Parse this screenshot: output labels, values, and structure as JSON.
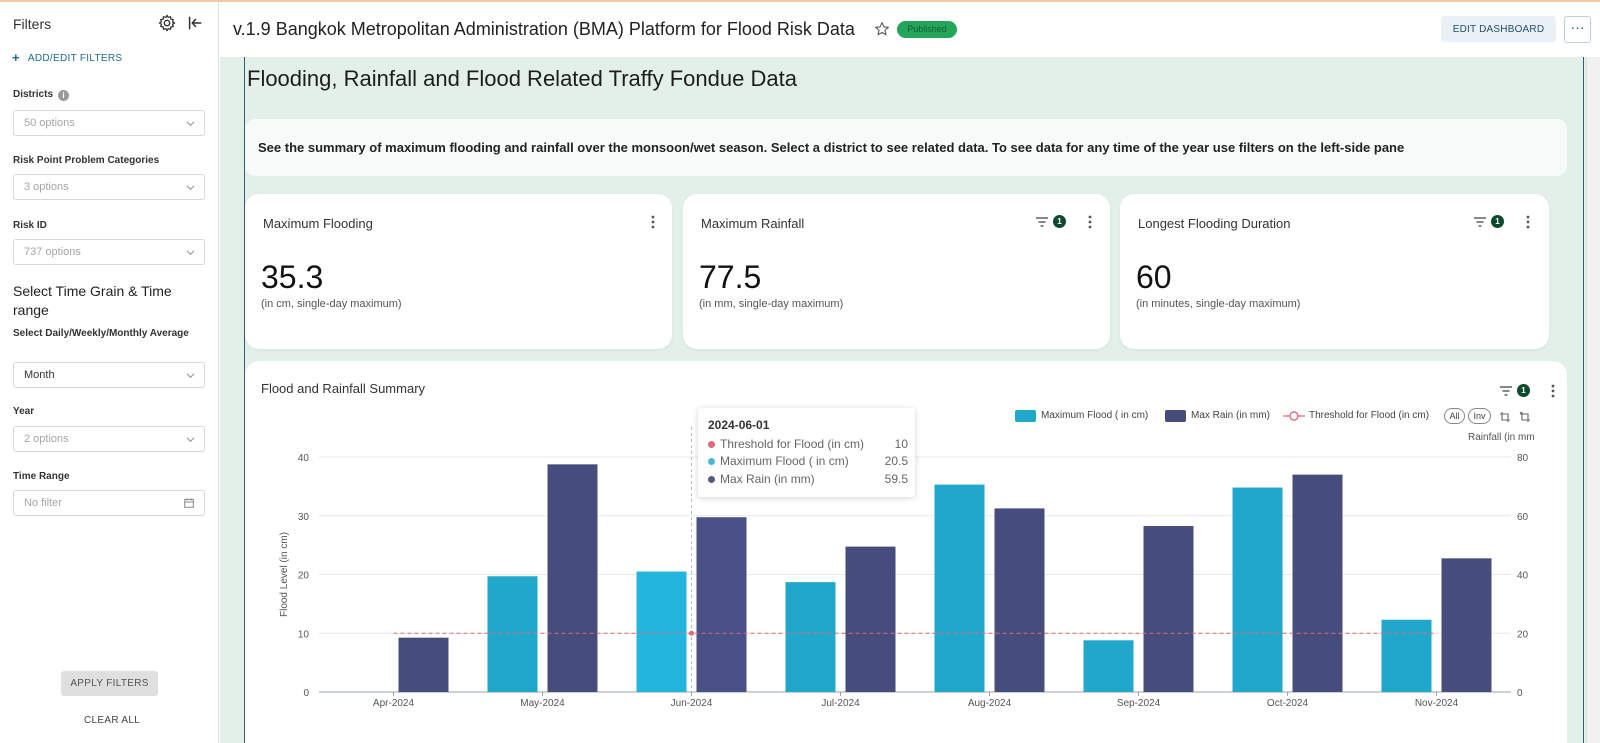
{
  "sidebar": {
    "title": "Filters",
    "add_filters": "ADD/EDIT FILTERS",
    "filters": [
      {
        "label": "Districts",
        "placeholder": "50 options"
      },
      {
        "label": "Risk Point Problem Categories",
        "placeholder": "3 options"
      },
      {
        "label": "Risk ID",
        "placeholder": "737 options"
      }
    ],
    "section_title": "Select Time Grain & Time range",
    "grain": {
      "label": "Select Daily/Weekly/Monthly Average",
      "value": "Month"
    },
    "year": {
      "label": "Year",
      "placeholder": "2 options"
    },
    "time_range": {
      "label": "Time Range",
      "placeholder": "No filter"
    },
    "apply": "APPLY FILTERS",
    "clear": "CLEAR ALL"
  },
  "header": {
    "title": "v.1.9 Bangkok Metropolitan Administration (BMA) Platform for Flood Risk Data",
    "status": "Published",
    "edit": "EDIT DASHBOARD",
    "more": "···"
  },
  "main": {
    "title": "Flooding, Rainfall and Flood Related Traffy Fondue Data",
    "intro": "See the summary of maximum flooding and rainfall over the monsoon/wet season. Select a district to see related data. To see data for any time of the year use filters on the left-side pane"
  },
  "kpis": [
    {
      "title": "Maximum Flooding",
      "value": "35.3",
      "subtitle": "(in cm, single-day maximum)"
    },
    {
      "title": "Maximum Rainfall",
      "value": "77.5",
      "subtitle": "(in mm, single-day maximum)",
      "filter_count": "1"
    },
    {
      "title": "Longest Flooding Duration",
      "value": "60",
      "subtitle": "(in minutes, single-day maximum)",
      "filter_count": "1"
    }
  ],
  "chart_card": {
    "title": "Flood and Rainfall Summary",
    "filter_count": "1",
    "legend": [
      "Maximum Flood ( in cm)",
      "Max Rain (in mm)",
      "Threshold for Flood (in cm)"
    ],
    "legend_all": "All",
    "legend_inv": "Inv",
    "right_axis_label": "Rainfall (in mm"
  },
  "tooltip": {
    "date": "2024-06-01",
    "rows": [
      {
        "name": "Threshold for Flood (in cm)",
        "value": "10",
        "color": "#e06a76"
      },
      {
        "name": "Maximum Flood ( in cm)",
        "value": "20.5",
        "color": "#4db6d6"
      },
      {
        "name": "Max Rain (in mm)",
        "value": "59.5",
        "color": "#55597f"
      }
    ]
  },
  "chart_data": {
    "type": "bar",
    "categories": [
      "Apr-2024",
      "May-2024",
      "Jun-2024",
      "Jul-2024",
      "Aug-2024",
      "Sep-2024",
      "Oct-2024",
      "Nov-2024"
    ],
    "series": [
      {
        "name": "Maximum Flood ( in cm)",
        "axis": "left",
        "color": "#21a7cb",
        "values": [
          null,
          19.7,
          20.5,
          18.7,
          35.3,
          8.8,
          34.8,
          12.3
        ]
      },
      {
        "name": "Max Rain (in mm)",
        "axis": "right",
        "color": "#464d7c",
        "values": [
          18.5,
          77.5,
          59.5,
          49.5,
          62.5,
          56.5,
          74.0,
          45.5
        ]
      },
      {
        "name": "Threshold for Flood (in cm)",
        "axis": "left",
        "type": "line",
        "style": "dashed",
        "color": "#e06a76",
        "values": [
          10,
          10,
          10,
          10,
          10,
          10,
          10,
          10
        ]
      }
    ],
    "ylabel": "Flood Level (in cm)",
    "y2label": "Rainfall (in mm",
    "ylim": [
      0,
      40
    ],
    "y2lim": [
      0,
      80
    ],
    "yticks": [
      0,
      10,
      20,
      30,
      40
    ],
    "y2ticks": [
      0,
      20,
      40,
      60,
      80
    ],
    "grid": true,
    "legend_position": "top-right"
  }
}
